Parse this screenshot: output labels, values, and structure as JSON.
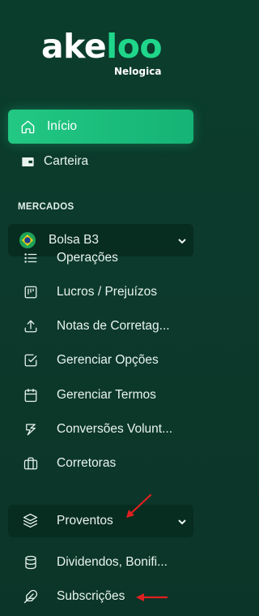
{
  "brand": {
    "logo_part1": "ake",
    "logo_part2": "loo",
    "subtitle": "Nelogica"
  },
  "nav": {
    "inicio": "Início",
    "carteira": "Carteira"
  },
  "section": {
    "mercados": "MERCADOS"
  },
  "groups": {
    "bolsa": "Bolsa B3",
    "proventos": "Proventos"
  },
  "bolsa_items": [
    {
      "label": "Operações",
      "icon": "list-icon"
    },
    {
      "label": "Lucros / Prejuízos",
      "icon": "board-icon"
    },
    {
      "label": "Notas de Corretag...",
      "icon": "upload-icon"
    },
    {
      "label": "Gerenciar Opções",
      "icon": "check-square-icon"
    },
    {
      "label": "Gerenciar Termos",
      "icon": "calendar-icon"
    },
    {
      "label": "Conversões Volunt...",
      "icon": "convert-icon"
    },
    {
      "label": "Corretoras",
      "icon": "briefcase-icon"
    }
  ],
  "proventos_items": [
    {
      "label": "Dividendos, Bonifi...",
      "icon": "database-icon"
    },
    {
      "label": "Subscrições",
      "icon": "feather-icon"
    }
  ],
  "colors": {
    "background": "#0b3d2c",
    "accent": "#22c883",
    "group_bg": "#072c20",
    "annotation_arrow": "#e02020"
  }
}
